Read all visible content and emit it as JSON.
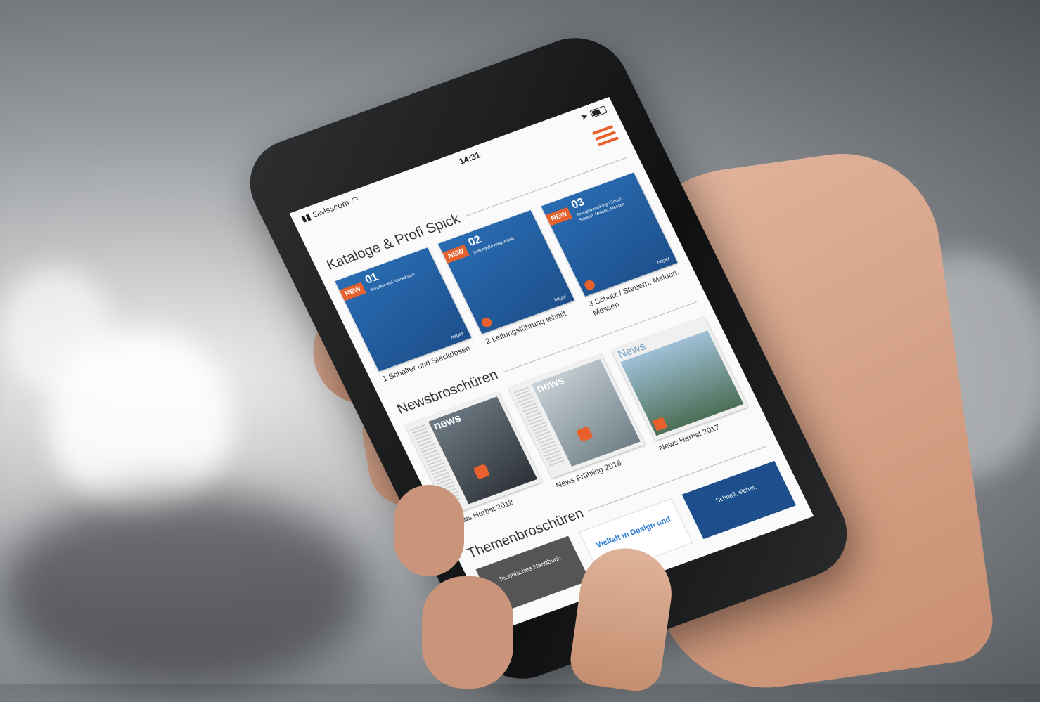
{
  "status": {
    "carrier": "Swisscom",
    "time": "14:31"
  },
  "sections": [
    {
      "title": "Kataloge & Profi Spick",
      "items": [
        {
          "badge": "NEW",
          "number": "01",
          "cover_text": "Schalter und Steckdosen",
          "caption": "1 Schalter und Steckdosen"
        },
        {
          "badge": "NEW",
          "number": "02",
          "cover_text": "Leitungsführung tehalit",
          "caption": "2 Leitungsführung tehalit"
        },
        {
          "badge": "NEW",
          "number": "03",
          "cover_text": "Energieverteilung / Schutz, Steuern, Melden, Messen",
          "caption": "3 Schutz / Steuern, Melden, Messen"
        }
      ]
    },
    {
      "title": "Newsbroschüren",
      "items": [
        {
          "mast": "news",
          "caption": "News Herbst 2018"
        },
        {
          "mast": "news",
          "caption": "News Frühling 2018"
        },
        {
          "mast": "News",
          "caption": "News Herbst 2017"
        }
      ]
    },
    {
      "title": "Themenbroschüren",
      "items": [
        {
          "cover_text": "Technisches Handbuch"
        },
        {
          "cover_text": "Vielfalt in Design und"
        },
        {
          "cover_text": "Schnell, sicher,"
        }
      ]
    }
  ],
  "brand": "hager",
  "colors": {
    "accent": "#e8612c",
    "catalog_blue": "#1d4f8c"
  }
}
